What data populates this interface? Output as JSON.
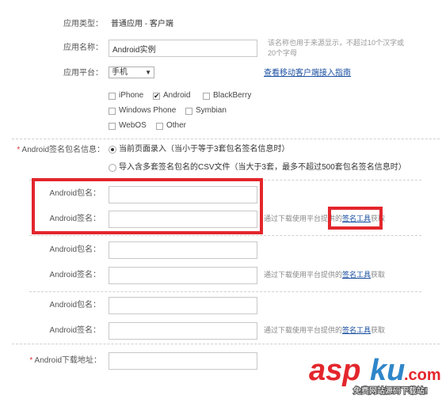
{
  "app_type": {
    "label": "应用类型：",
    "value": "普通应用 - 客户端"
  },
  "app_name": {
    "label": "应用名称：",
    "value": "Android实例",
    "hint": "该名称也用于来源显示，不超过10个汉字或20个字母"
  },
  "platform": {
    "label": "应用平台：",
    "selected": "手机",
    "guide_link": "查看移动客户端接入指南",
    "options": [
      {
        "label": "iPhone",
        "checked": false
      },
      {
        "label": "Android",
        "checked": true
      },
      {
        "label": "BlackBerry",
        "checked": false
      },
      {
        "label": "Windows Phone",
        "checked": false
      },
      {
        "label": "Symbian",
        "checked": false
      },
      {
        "label": "WebOS",
        "checked": false
      },
      {
        "label": "Other",
        "checked": false
      }
    ]
  },
  "sign_info": {
    "label": "Android签名包名信息：",
    "radio1": "当前页面录入（当小于等于3套包名签名信息时）",
    "radio2": "导入含多套签名包名的CSV文件（当大于3套，最多不超过500套包名签名信息时）"
  },
  "groups": [
    {
      "pkg_label": "Android包名：",
      "sig_label": "Android签名：",
      "tool_prefix": "通过下载使用平台提供的",
      "tool_link": "签名工具",
      "tool_suffix": "获取"
    },
    {
      "pkg_label": "Android包名：",
      "sig_label": "Android签名：",
      "tool_prefix": "通过下载使用平台提供的",
      "tool_link": "签名工具",
      "tool_suffix": "获取"
    },
    {
      "pkg_label": "Android包名：",
      "sig_label": "Android签名：",
      "tool_prefix": "通过下载使用平台提供的",
      "tool_link": "签名工具",
      "tool_suffix": "获取"
    }
  ],
  "download": {
    "label": "Android下载地址："
  },
  "watermark": {
    "brand": "aspku.com",
    "tagline": "免费网站源码下载站!"
  },
  "colors": {
    "highlight": "#e3262c",
    "link": "#1a4fa0",
    "required": "#dd3333"
  }
}
